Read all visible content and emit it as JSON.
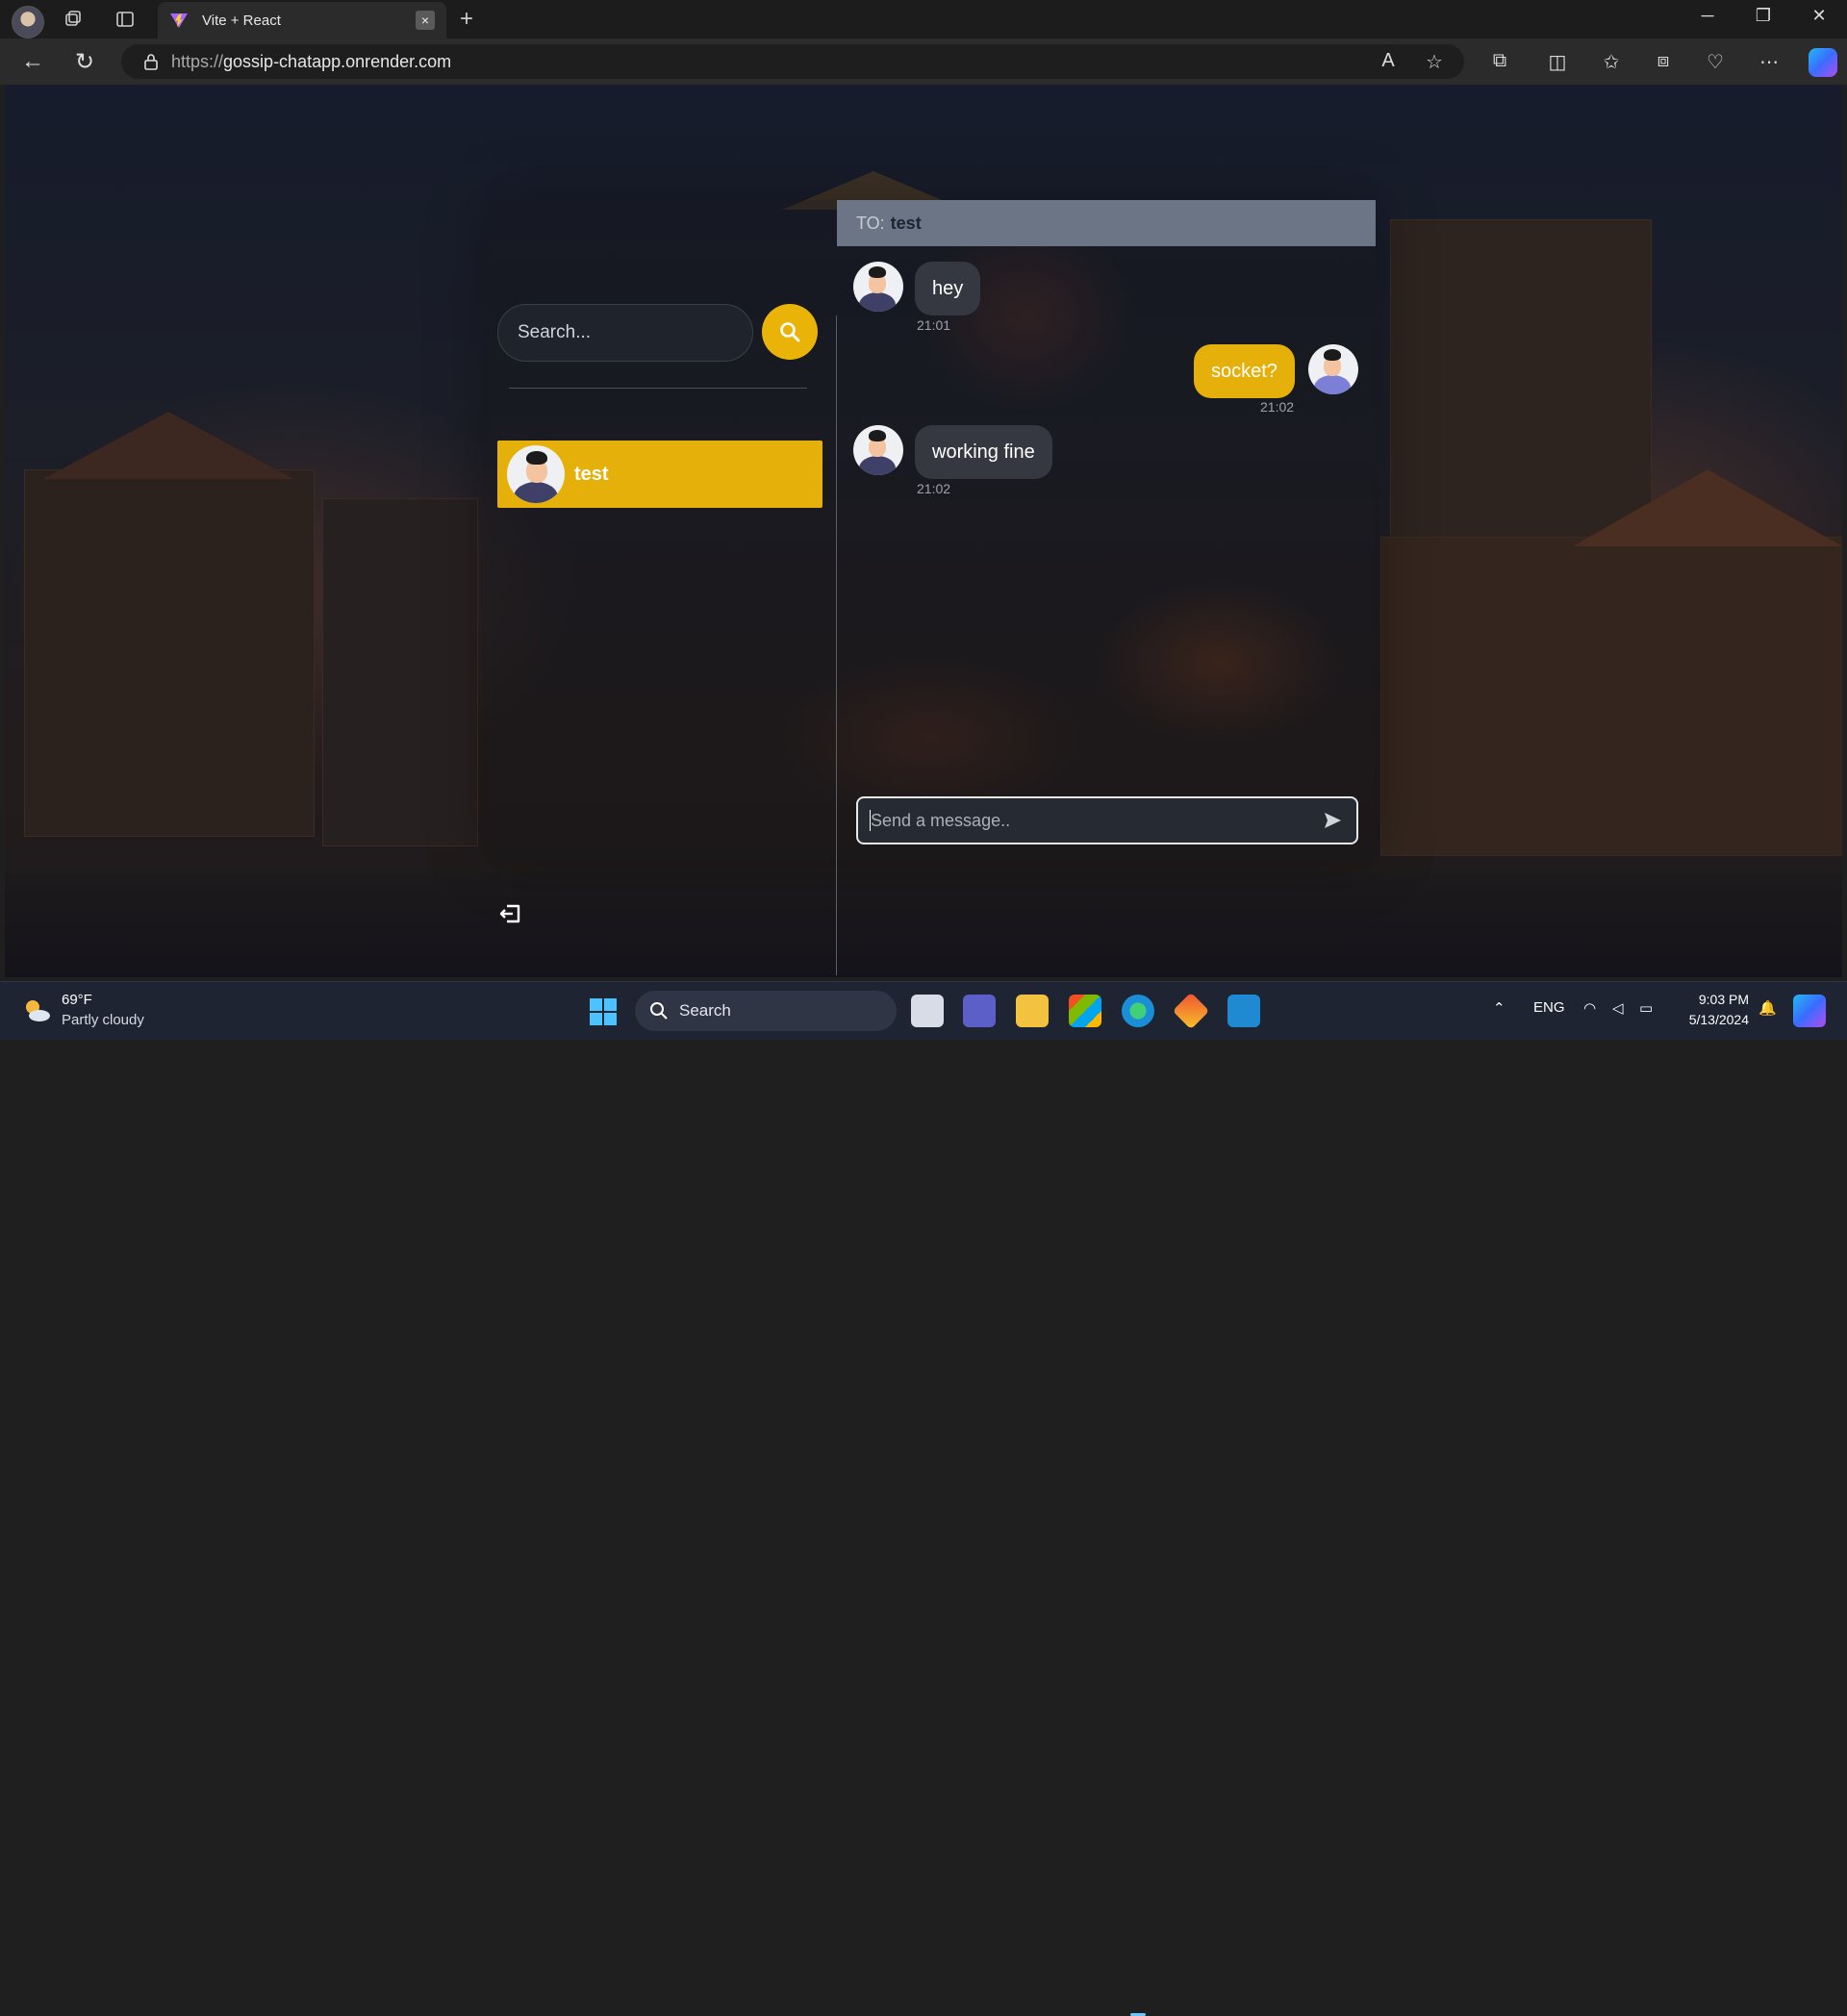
{
  "browser": {
    "tab_title": "Vite + React",
    "url_protocol": "https://",
    "url_host": "gossip-chatapp.onrender.com",
    "new_tab_symbol": "+",
    "close_symbol": "×"
  },
  "sidebar": {
    "search_placeholder": "Search...",
    "conversations": [
      {
        "name": "test",
        "selected": true
      }
    ]
  },
  "chat": {
    "to_label": "TO:",
    "recipient": "test",
    "messages": [
      {
        "text": "hey",
        "time": "21:01",
        "from_me": false
      },
      {
        "text": "socket?",
        "time": "21:02",
        "from_me": true
      },
      {
        "text": "working fine",
        "time": "21:02",
        "from_me": false
      }
    ],
    "input_placeholder": "Send a message.."
  },
  "taskbar": {
    "weather_temp": "69°F",
    "weather_desc": "Partly cloudy",
    "search_label": "Search",
    "language": "ENG",
    "time": "9:03 PM",
    "date": "5/13/2024"
  },
  "colors": {
    "accent": "#eab308",
    "header": "#6b7585",
    "bubble_other": "#353840"
  }
}
